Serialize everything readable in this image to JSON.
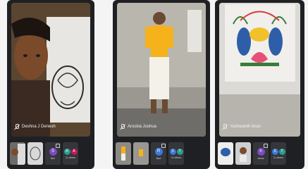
{
  "tiles": [
    {
      "name": "Deshna J Denesh",
      "participants": [
        {
          "label": "Bini",
          "initial": "S"
        }
      ],
      "others_label": "11 others",
      "others_initials": [
        "R",
        "A"
      ]
    },
    {
      "name": "Arockia Joshua",
      "participants": [
        {
          "label": "Bavi",
          "initial": "R"
        }
      ],
      "others_label": "11 others",
      "others_initials": [
        "S",
        "T"
      ]
    },
    {
      "name": "Yashwanth kiran",
      "participants": [
        {
          "label": "hema",
          "initial": "h"
        }
      ],
      "others_label": "11 others",
      "others_initials": [
        "S",
        "T"
      ]
    }
  ],
  "colors": {
    "panel": "#1f2023",
    "avatar_purple": "#7b4bbf",
    "avatar_blue": "#3c78d8",
    "avatar_teal": "#2a9d8f",
    "avatar_pink": "#c2185b"
  },
  "icons": [
    "mic-off-icon",
    "more-icon"
  ]
}
